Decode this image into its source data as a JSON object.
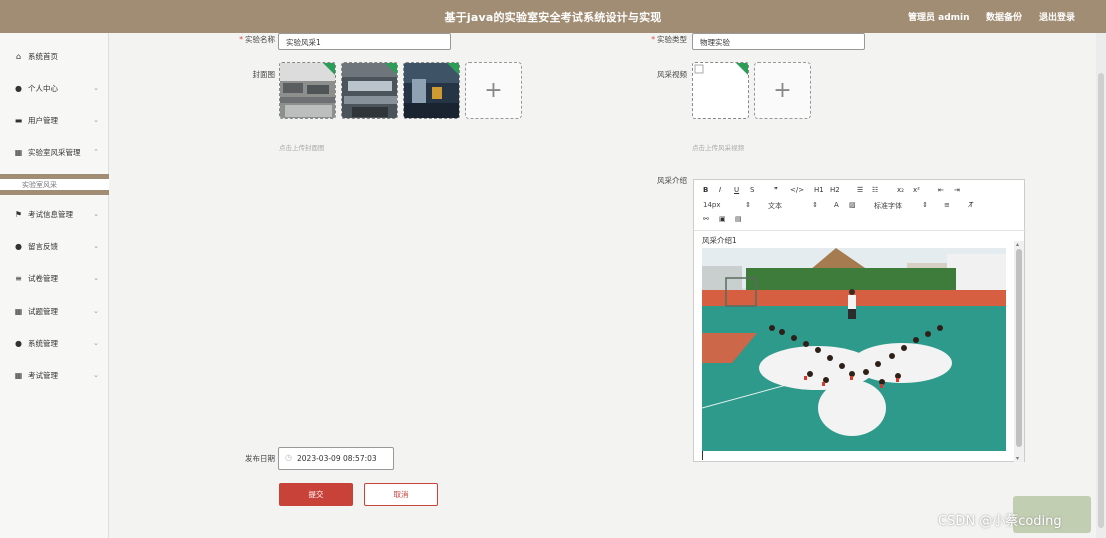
{
  "header": {
    "title": "基于java的实验室安全考试系统设计与实现",
    "admin_label": "管理员 admin",
    "backup_label": "数据备份",
    "logout_label": "退出登录"
  },
  "sidebar": {
    "items": [
      {
        "label": "系统首页",
        "icon": "home-icon",
        "chevron": ""
      },
      {
        "label": "个人中心",
        "icon": "user-icon",
        "chevron": "⌄"
      },
      {
        "label": "用户管理",
        "icon": "monitor-icon",
        "chevron": "⌄"
      },
      {
        "label": "实验室风采管理",
        "icon": "grid-icon",
        "chevron": "⌃"
      },
      {
        "label": "考试信息管理",
        "icon": "flag-icon",
        "chevron": "⌄"
      },
      {
        "label": "留言反馈",
        "icon": "pin-icon",
        "chevron": "⌄"
      },
      {
        "label": "试卷管理",
        "icon": "list-icon",
        "chevron": "⌄"
      },
      {
        "label": "试题管理",
        "icon": "grid-icon",
        "chevron": "⌄"
      },
      {
        "label": "系统管理",
        "icon": "user-icon",
        "chevron": "⌄"
      },
      {
        "label": "考试管理",
        "icon": "grid-icon",
        "chevron": "⌄"
      }
    ],
    "active_sub": "实验室风采"
  },
  "form": {
    "name_label": "实验名称",
    "name_value": "实验风采1",
    "type_label": "实验类型",
    "type_value": "物理实验",
    "cover_label": "封面图",
    "cover_hint": "点击上传封面图",
    "video_label": "风采视频",
    "video_hint": "点击上传风采视频",
    "intro_label": "风采介绍",
    "date_label": "发布日期",
    "date_value": "2023-03-09 08:57:03",
    "submit_label": "提交",
    "cancel_label": "取消",
    "plus": "+"
  },
  "editor": {
    "font_size": "14px",
    "text_type": "文本",
    "font_family": "标准字体",
    "content_text": "风采介绍1",
    "toolbar_row1": [
      "B",
      "I",
      "U",
      "S",
      "❞",
      "</>",
      "H1",
      "H2",
      "☰",
      "☷",
      "x₂",
      "x²",
      "⇤",
      "⇥"
    ],
    "toolbar_row1_names": [
      "bold",
      "italic",
      "underline",
      "strike",
      "quote",
      "code",
      "h1",
      "h2",
      "ordered-list",
      "bullet-list",
      "subscript",
      "superscript",
      "outdent",
      "indent"
    ],
    "toolbar_row2_icons": [
      "A",
      "▨",
      "≡",
      "T̸"
    ],
    "toolbar_row3_icons": [
      "⚯",
      "▣",
      "▤"
    ]
  },
  "watermark": "CSDN @小蔡coding",
  "colors": {
    "header_bg": "#a18d73",
    "submit_bg": "#c9423a",
    "cancel_border": "#c9423a"
  }
}
